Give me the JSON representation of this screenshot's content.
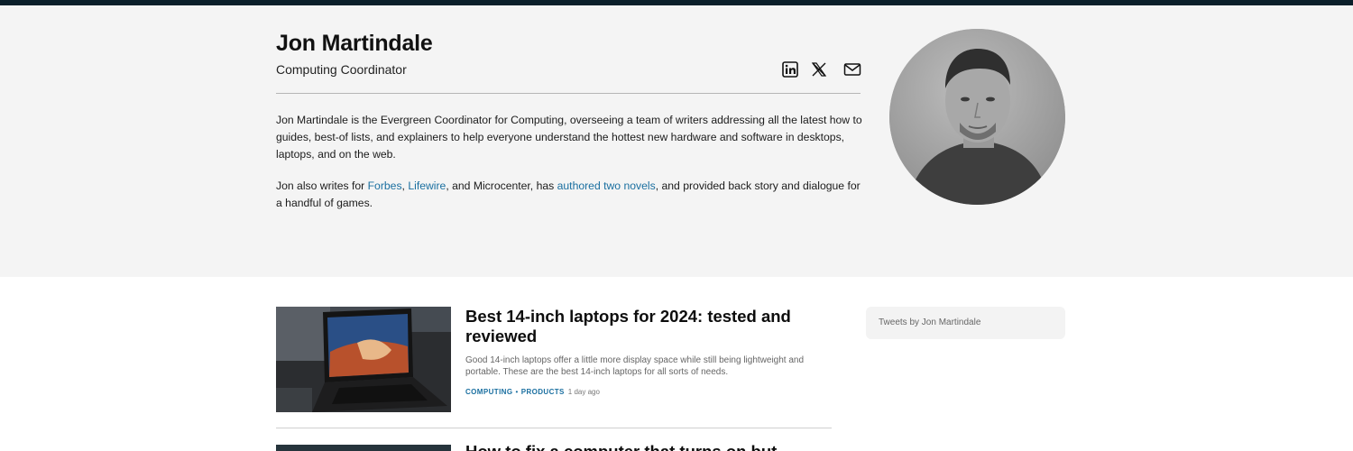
{
  "author": {
    "name": "Jon Martindale",
    "role": "Computing Coordinator"
  },
  "social": [
    {
      "name": "linkedin-icon"
    },
    {
      "name": "x-twitter-icon"
    },
    {
      "name": "email-icon"
    }
  ],
  "bio": {
    "p1": "Jon Martindale is the Evergreen Coordinator for Computing, overseeing a team of writers addressing all the latest how to guides, best-of lists, and explainers to help everyone understand the hottest new hardware and software in desktops, laptops, and on the web.",
    "p2_before": "Jon also writes for ",
    "link_forbes": "Forbes",
    "comma": ", ",
    "link_lifewire": "Lifewire",
    "p2_middle": ", and Microcenter, has ",
    "link_novels": "authored two novels",
    "p2_after": ", and provided back story and dialogue for a handful of games."
  },
  "articles": [
    {
      "title": "Best 14-inch laptops for 2024: tested and reviewed",
      "description": "Good 14-inch laptops offer a little more display space while still being lightweight and portable. These are the best 14-inch laptops for all sorts of needs.",
      "category1": "COMPUTING",
      "separator": "•",
      "category2": "PRODUCTS",
      "time": "1 day ago"
    },
    {
      "title": "How to fix a computer that turns on but"
    }
  ],
  "tweets": {
    "label": "Tweets by Jon Martindale"
  },
  "colors": {
    "topbar": "#0b1f2a",
    "hero_bg": "#f4f4f4",
    "link": "#1a6fa0"
  }
}
